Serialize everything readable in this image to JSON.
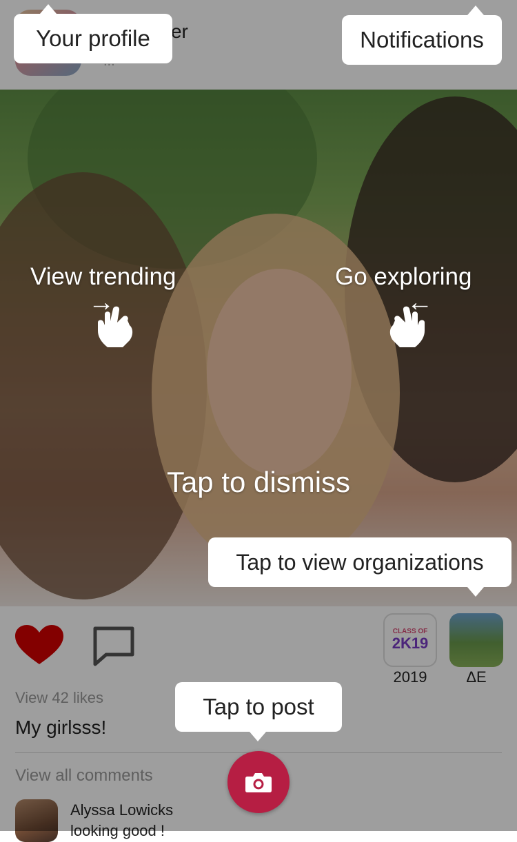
{
  "header": {
    "user_name": "Miller",
    "user_sub": "..."
  },
  "post": {
    "likes_link": "View 42 likes",
    "caption": "My girlsss!",
    "comments_link": "View all comments",
    "comment": {
      "author": "Alyssa Lowicks",
      "text": "looking good !"
    }
  },
  "organizations": [
    {
      "label": "2019",
      "badge_small": "CLASS OF",
      "badge_big": "2K19"
    },
    {
      "label": "ΔE"
    }
  ],
  "onboarding": {
    "profile_tip": "Your profile",
    "notifications_tip": "Notifications",
    "trending_hint": "View trending",
    "exploring_hint": "Go exploring",
    "dismiss": "Tap to dismiss",
    "organizations_tip": "Tap to view organizations",
    "post_tip": "Tap to post"
  },
  "icons": {
    "like": "heart-icon",
    "comment": "comment-icon",
    "post": "camera-icon",
    "swipe": "hand-pointer-icon",
    "arrow_right": "→",
    "arrow_left": "←"
  },
  "colors": {
    "like": "#d40000",
    "post_button": "#b61e43",
    "overlay": "rgba(0,0,0,0.38)"
  }
}
